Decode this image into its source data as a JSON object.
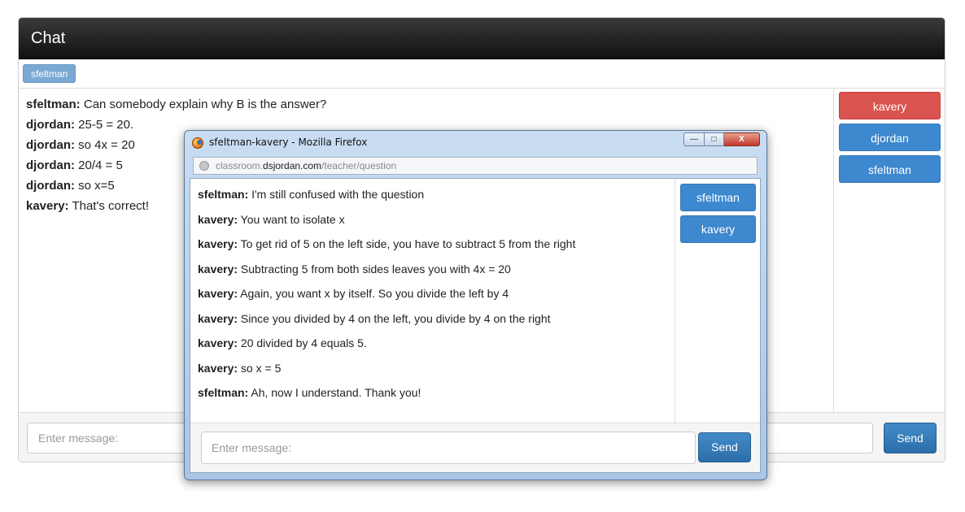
{
  "chat": {
    "title": "Chat",
    "active_tab": "sfeltman",
    "messages": [
      {
        "user": "sfeltman:",
        "text": " Can somebody explain why B is the answer?"
      },
      {
        "user": "djordan:",
        "text": " 25-5 = 20."
      },
      {
        "user": "djordan:",
        "text": " so 4x = 20"
      },
      {
        "user": "djordan:",
        "text": " 20/4 = 5"
      },
      {
        "user": "djordan:",
        "text": " so x=5"
      },
      {
        "user": "kavery:",
        "text": " That's correct!"
      }
    ],
    "users": [
      "kavery",
      "djordan",
      "sfeltman"
    ],
    "input_placeholder": "Enter message:",
    "send_label": "Send"
  },
  "popup": {
    "window_title": "sfeltman-kavery - Mozilla Firefox",
    "url_prefix": "classroom.",
    "url_domain": "dsjordan.com",
    "url_path": "/teacher/question",
    "win_min": "—",
    "win_max": "□",
    "win_close": "X",
    "messages": [
      {
        "user": "sfeltman:",
        "text": " I'm still confused with the question"
      },
      {
        "user": "kavery:",
        "text": " You want to isolate x"
      },
      {
        "user": "kavery:",
        "text": " To get rid of 5 on the left side, you have to subtract 5 from the right"
      },
      {
        "user": "kavery:",
        "text": " Subtracting 5 from both sides leaves you with 4x = 20"
      },
      {
        "user": "kavery:",
        "text": " Again, you want x by itself. So you divide the left by 4"
      },
      {
        "user": "kavery:",
        "text": " Since you divided by 4 on the left, you divide by 4 on the right"
      },
      {
        "user": "kavery:",
        "text": " 20 divided by 4 equals 5."
      },
      {
        "user": "kavery:",
        "text": " so x = 5"
      },
      {
        "user": "sfeltman:",
        "text": " Ah, now I understand. Thank you!"
      }
    ],
    "users": [
      "sfeltman",
      "kavery"
    ],
    "input_placeholder": "Enter message:",
    "send_label": "Send"
  },
  "colors": {
    "header_bg": "#1a1a1a",
    "primary": "#3e88cf",
    "danger": "#d9534f",
    "tab_chip": "#7aa9d3"
  }
}
